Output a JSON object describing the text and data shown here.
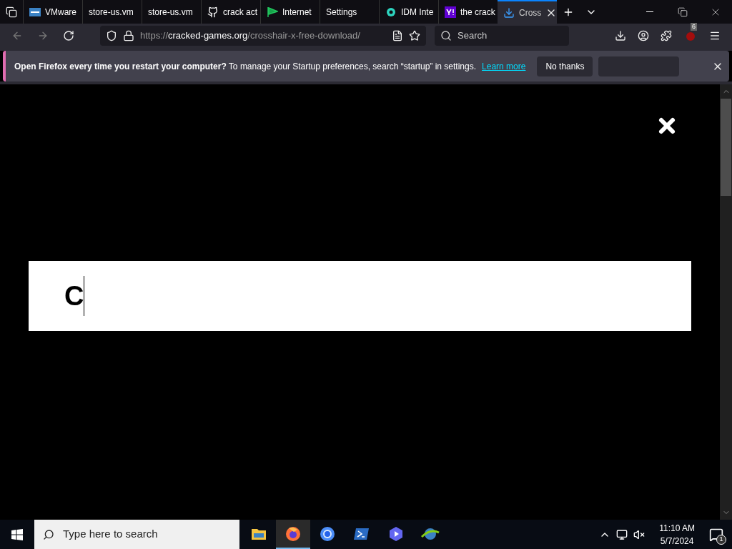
{
  "tabs": [
    {
      "title": "VMware",
      "selected": false
    },
    {
      "title": "store-us.vm",
      "selected": false
    },
    {
      "title": "store-us.vm",
      "selected": false
    },
    {
      "title": "crack act",
      "selected": false
    },
    {
      "title": "Internet",
      "selected": false
    },
    {
      "title": "Settings",
      "selected": false
    },
    {
      "title": "IDM Inte",
      "selected": false
    },
    {
      "title": "the crack",
      "selected": false
    },
    {
      "title": "Cross",
      "selected": true
    }
  ],
  "toolbar": {
    "url_scheme": "https://",
    "url_host": "cracked-games.org",
    "url_path": "/crosshair-x-free-download/",
    "search_placeholder": "Search",
    "extension_badge": "6"
  },
  "notification": {
    "message": "**Open Firefox every time you restart your computer?** To manage your Startup preferences, search “startup” in settings.",
    "link": "Learn more",
    "buttons": [
      "No thanks"
    ]
  },
  "page": {
    "input_value": "C"
  },
  "taskbar": {
    "search_placeholder": "Type here to search",
    "apps": [
      {
        "selected": false
      },
      {
        "selected": true
      },
      {
        "selected": false
      },
      {
        "selected": false
      },
      {
        "selected": false
      },
      {
        "selected": false
      }
    ],
    "time": "11:10 AM",
    "date": "5/7/2024",
    "notification_count": "1"
  }
}
